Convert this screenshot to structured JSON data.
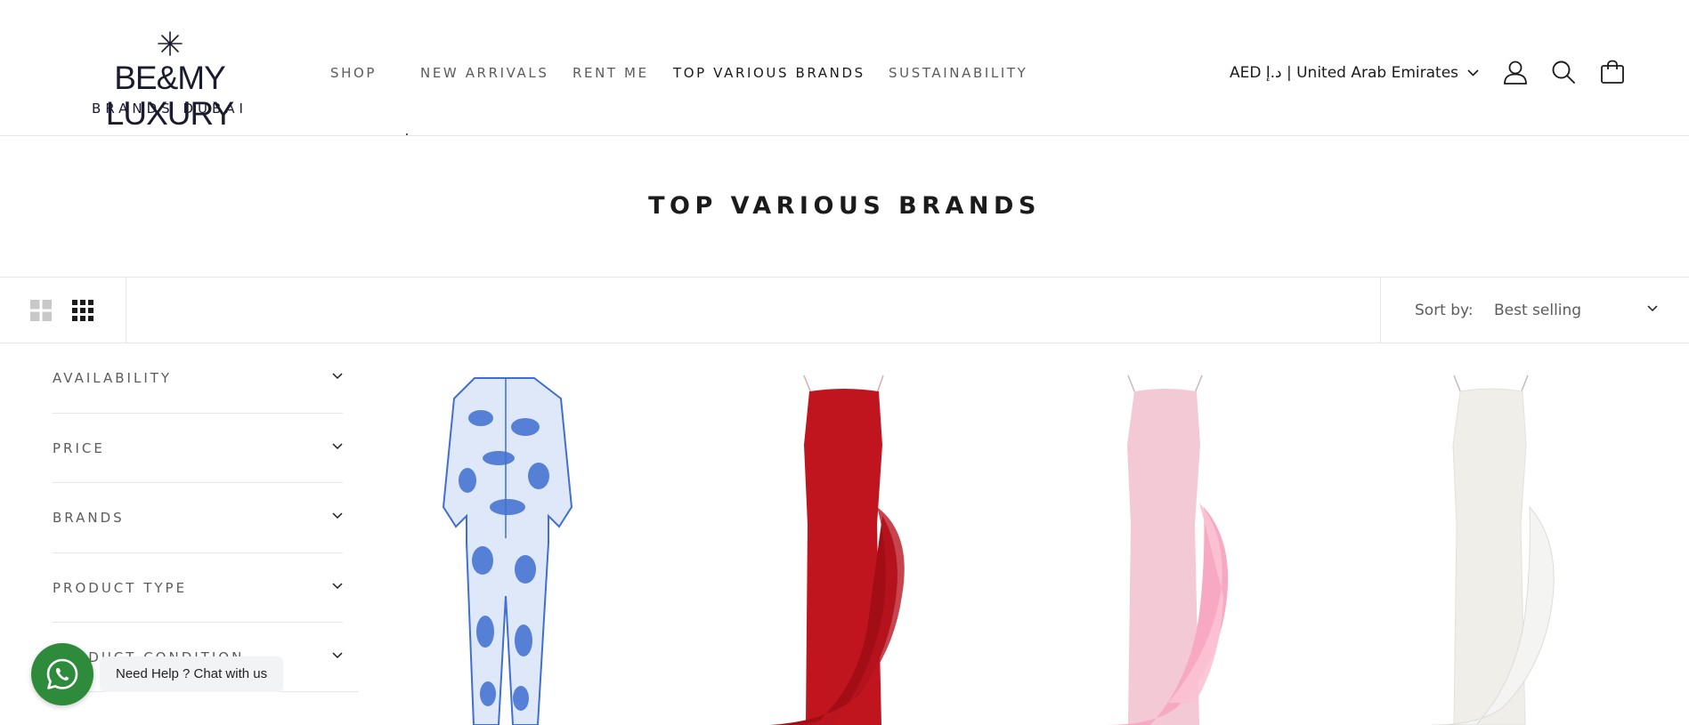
{
  "header": {
    "logo": {
      "main": "BE&MY LUXURY",
      "sub": "BRANDS DUBAI"
    },
    "nav": [
      {
        "label": "SHOP",
        "active": false
      },
      {
        "label": "NEW ARRIVALS",
        "active": false
      },
      {
        "label": "RENT ME",
        "active": false
      },
      {
        "label": "TOP VARIOUS BRANDS",
        "active": true
      },
      {
        "label": "SUSTAINABILITY",
        "active": false
      }
    ],
    "locale": "AED د.إ | United Arab Emirates",
    "icons": [
      "account-icon",
      "search-icon",
      "cart-icon"
    ]
  },
  "page": {
    "title": "TOP VARIOUS BRANDS"
  },
  "toolbar": {
    "view_modes": [
      "grid-2-icon",
      "grid-3-icon"
    ],
    "sort_label": "Sort by:",
    "sort_value": "Best selling"
  },
  "filters": [
    {
      "label": "AVAILABILITY"
    },
    {
      "label": "PRICE"
    },
    {
      "label": "BRANDS"
    },
    {
      "label": "PRODUCT TYPE"
    },
    {
      "label": "PRODUCT CONDITION"
    }
  ],
  "products": [
    {
      "image": "blue-toile-pajama-set",
      "color": "#3f6fd0"
    },
    {
      "image": "red-feather-slip-dress",
      "color": "#c0141e"
    },
    {
      "image": "pink-feather-slip-dress",
      "color": "#f3b9cb"
    },
    {
      "image": "white-feather-slip-dress",
      "color": "#efeee8"
    }
  ],
  "whatsapp": {
    "label": "Need Help ? Chat with us",
    "color": "#2e8b3b"
  }
}
